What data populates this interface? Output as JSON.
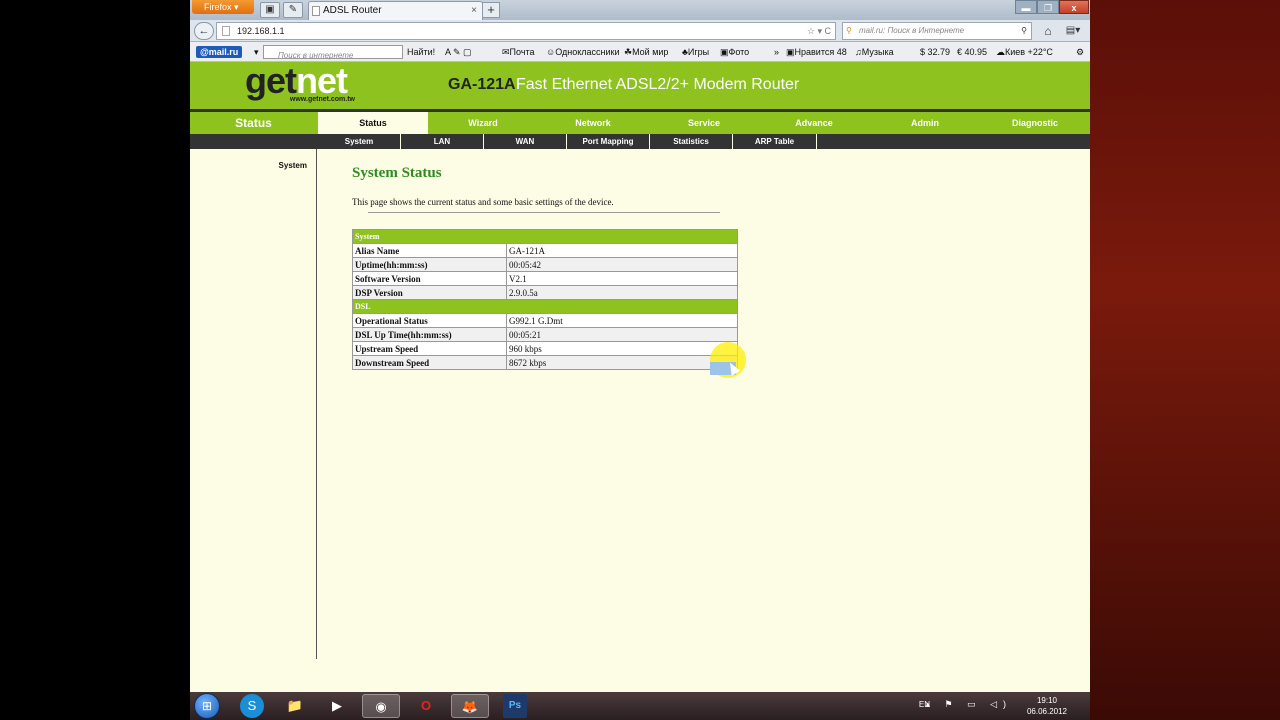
{
  "browser": {
    "app_button": "Firefox",
    "tab_title": "ADSL Router",
    "tab_close": "×",
    "new_tab": "+",
    "back": "←",
    "url": "192.168.1.1",
    "url_glyphs": "☆ ▾ C",
    "search_placeholder": "mail.ru: Поиск в Интернете",
    "search_icon": "search-icon",
    "home": "⌂",
    "minimize": "▬",
    "maximize": "❐",
    "close": "x"
  },
  "mailru_toolbar": {
    "logo": "@mail.ru",
    "search_placeholder": "Поиск в интернете",
    "find": "Найти!",
    "mail": "Почта",
    "odnoklassniki": "Одноклассники",
    "my_world": "Мой мир",
    "games": "Игры",
    "photo": "Фото",
    "more": "»",
    "likes": "Нравится 48",
    "music": "Музыка",
    "usd": "$ 32.79",
    "eur": "€ 40.95",
    "weather": "Киев +22°C"
  },
  "router": {
    "logo_word_a": "get",
    "logo_word_b": "net",
    "logo_site": "www.getnet.com.tw",
    "model": "GA-121A",
    "product_name": "Fast Ethernet ADSL2/2+ Modem Router",
    "side_title": "Status",
    "main_tabs": [
      "Status",
      "Wizard",
      "Network",
      "Service",
      "Advance",
      "Admin",
      "Diagnostic"
    ],
    "sub_tabs": [
      "System",
      "LAN",
      "WAN",
      "Port Mapping",
      "Statistics",
      "ARP Table"
    ],
    "sidebar_link": "System",
    "page_title": "System Status",
    "description": "This page shows the current status and some basic settings of the device.",
    "sections": [
      {
        "title": "System",
        "rows": [
          {
            "label": "Alias Name",
            "value": "GA-121A"
          },
          {
            "label": "Uptime(hh:mm:ss)",
            "value": "00:05:42"
          },
          {
            "label": "Software Version",
            "value": "V2.1"
          },
          {
            "label": "DSP Version",
            "value": "2.9.0.5a"
          }
        ]
      },
      {
        "title": "DSL",
        "rows": [
          {
            "label": "Operational Status",
            "value": "G992.1 G.Dmt"
          },
          {
            "label": "DSL Up Time(hh:mm:ss)",
            "value": "00:05:21"
          },
          {
            "label": "Upstream Speed",
            "value": "960 kbps"
          },
          {
            "label": "Downstream Speed",
            "value": "8672 kbps"
          }
        ]
      }
    ]
  },
  "taskbar": {
    "start": "⊞",
    "apps": [
      "S",
      "📁",
      "▶",
      "◉",
      "O",
      "🦊",
      "Ps"
    ],
    "lang": "EN",
    "time": "19:10",
    "date": "06.06.2012"
  }
}
